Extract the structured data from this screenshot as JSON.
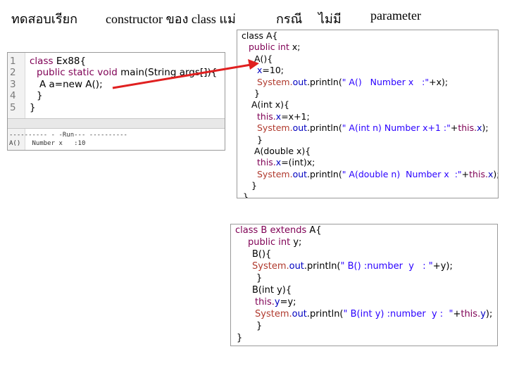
{
  "title": {
    "part1": "ทดสอบเรียก",
    "part2": "constructor ของ class แม่",
    "part3": "กรณี",
    "part4": "ไม่มี",
    "part5": "parameter"
  },
  "editor": {
    "line_numbers": [
      "1",
      "2",
      "3",
      "4",
      "5"
    ],
    "l1_kw": "class ",
    "l1_name": "Ex88{",
    "l2_kw": "public static void ",
    "l2_rest": "main(String args[]){",
    "l3": "A a=new A();",
    "l4": "}",
    "l5": "}",
    "console_sep": "---------- - -Run--- ----------",
    "console_out": "A()   Number x   :10"
  },
  "class_a": {
    "l1": "class A{",
    "l2_kw": "public int ",
    "l2_field": "x",
    "l2_end": ";",
    "l3": "A(){",
    "l4_field": "x",
    "l4_rest": "=10;",
    "l5_sys": "System.",
    "l5_out": "out",
    "l5_call": ".println(",
    "l5_str": "\" A()   Number x   :\"",
    "l5_end": "+x);",
    "l6": "}",
    "l7": "A(int x){",
    "l8_kw": "this.",
    "l8_field": "x",
    "l8_rest": "=x+1;",
    "l9_sys": "System.",
    "l9_out": "out",
    "l9_call": ".println(",
    "l9_str": "\" A(int n) Number x+1 :\"",
    "l9_mid": "+",
    "l9_kw": "this.",
    "l9_field": "x",
    "l9_end": ");",
    "l10": "}",
    "l11": "A(double x){",
    "l12_kw": "this.",
    "l12_field": "x",
    "l12_rest": "=(int)x;",
    "l13_sys": "System.",
    "l13_out": "out",
    "l13_call": ".println(",
    "l13_str": "\" A(double n)  Number x  :\"",
    "l13_mid": "+",
    "l13_kw": "this.",
    "l13_field": "x",
    "l13_end": ");",
    "l14": "}",
    "l15": "}"
  },
  "class_b": {
    "l1_kw": "class B extends ",
    "l1_name": "A{",
    "l2_kw": "public int ",
    "l2_field": "y",
    "l2_end": ";",
    "l3": "B(){",
    "l4_sys": "System.",
    "l4_out": "out",
    "l4_call": ".println(",
    "l4_str": "\" B() :number  y   : \"",
    "l4_end": "+y);",
    "l5": "}",
    "l6": "B(int y){",
    "l7_kw": "this.",
    "l7_field": "y",
    "l7_rest": "=y;",
    "l8_sys": "System.",
    "l8_out": "out",
    "l8_call": ".println(",
    "l8_str": "\" B(int y) :number  y :  \"",
    "l8_mid": "+",
    "l8_kw": "this.",
    "l8_field": "y",
    "l8_end": ");",
    "l9": "}",
    "l10": "}"
  },
  "colors": {
    "keyword": "#7f0055",
    "field": "#0000c0",
    "string": "#2a00ff",
    "arrow": "#e02020"
  }
}
